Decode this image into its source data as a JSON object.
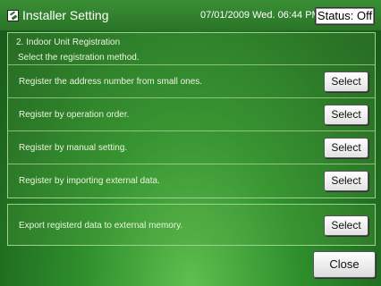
{
  "header": {
    "title": "Installer Setting",
    "datetime": "07/01/2009 Wed. 06:44 PM",
    "status": "Status: Off"
  },
  "section": {
    "title": "2. Indoor Unit Registration",
    "subtitle": "Select the registration method.",
    "options": [
      {
        "label": "Register the address number from small ones.",
        "button": "Select"
      },
      {
        "label": "Register by operation order.",
        "button": "Select"
      },
      {
        "label": "Register by manual setting.",
        "button": "Select"
      },
      {
        "label": "Register by importing external data.",
        "button": "Select"
      }
    ]
  },
  "export": {
    "label": "Export registerd data to external memory.",
    "button": "Select"
  },
  "footer": {
    "close_label": "Close"
  }
}
